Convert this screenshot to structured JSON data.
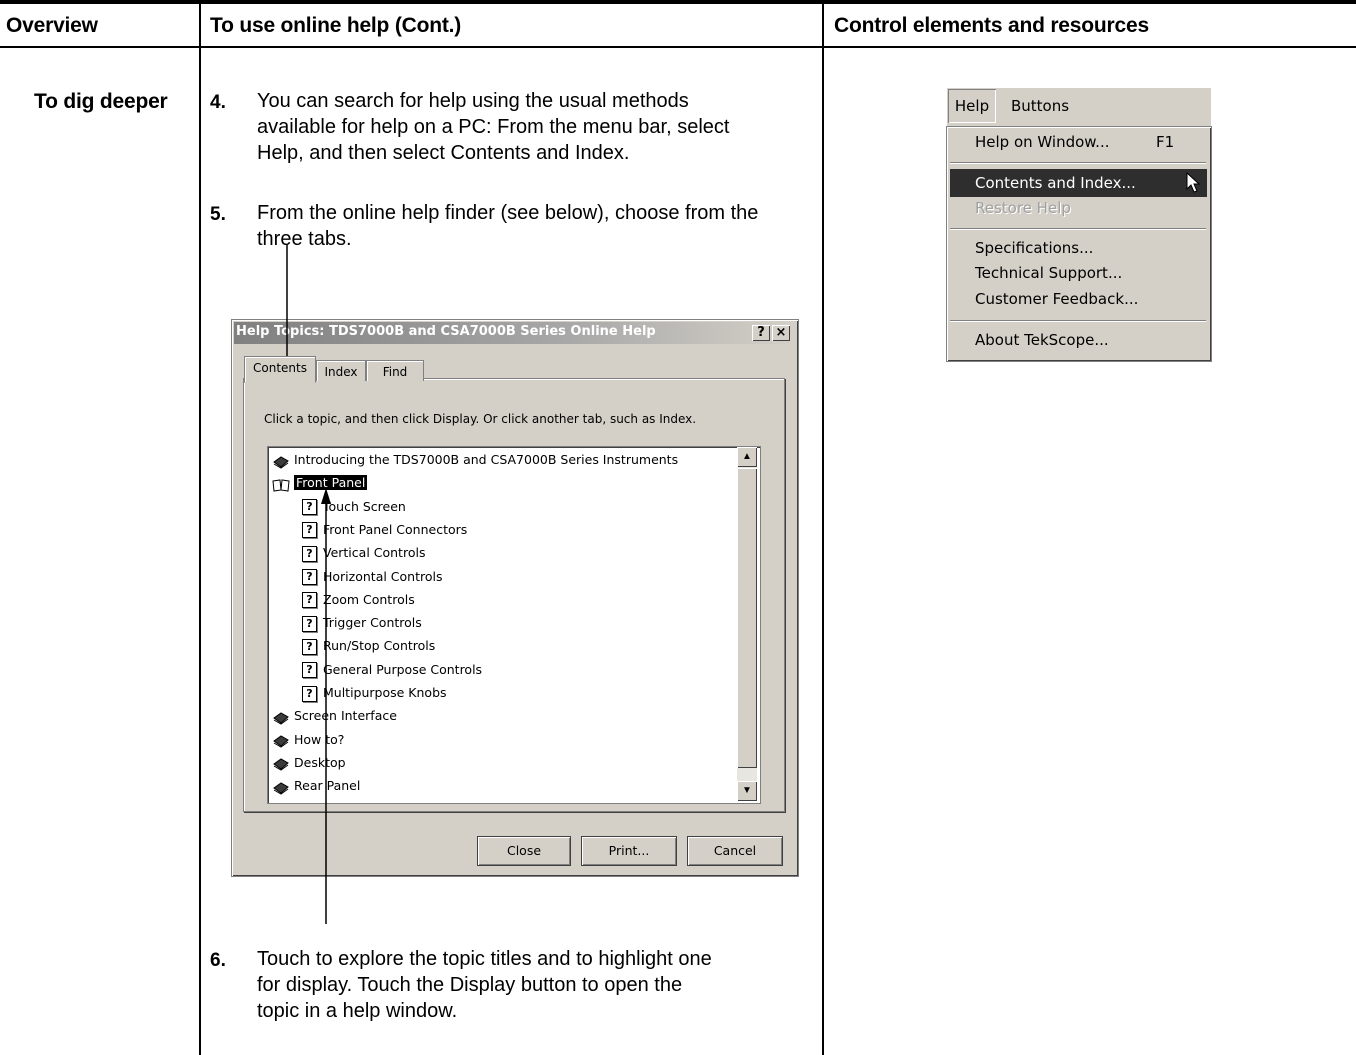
{
  "header": {
    "col1": "Overview",
    "col2": "To use online help (Cont.)",
    "col3": "Control elements and resources"
  },
  "section_label": "To dig deeper",
  "steps": [
    {
      "num": "4.",
      "lines": [
        "You can search for help using the usual methods",
        "available for help on a PC: From the menu bar, select",
        "Help, and then select Contents and Index."
      ]
    },
    {
      "num": "5.",
      "lines": [
        "From the online help finder (see below), choose from the",
        "three tabs."
      ]
    },
    {
      "num": "6.",
      "lines": [
        "Touch to explore the topic titles and to highlight one",
        "for display. Touch the Display button to open the",
        "topic in a help window."
      ]
    }
  ],
  "dialog": {
    "title": "Help Topics: TDS7000B and CSA7000B Series Online Help",
    "help_btn": "?",
    "close_btn": "×",
    "tabs": [
      "Contents",
      "Index",
      "Find"
    ],
    "instruction": "Click a topic, and then click Display. Or click another tab, such as Index.",
    "tree": [
      {
        "type": "book",
        "label": "Introducing the TDS7000B and CSA7000B Series Instruments"
      },
      {
        "type": "open-book",
        "label": "Front Panel",
        "selected": true
      },
      {
        "type": "topic",
        "label": "Touch Screen"
      },
      {
        "type": "topic",
        "label": "Front Panel Connectors"
      },
      {
        "type": "topic",
        "label": "Vertical Controls"
      },
      {
        "type": "topic",
        "label": "Horizontal Controls"
      },
      {
        "type": "topic",
        "label": "Zoom Controls"
      },
      {
        "type": "topic",
        "label": "Trigger Controls"
      },
      {
        "type": "topic",
        "label": "Run/Stop Controls"
      },
      {
        "type": "topic",
        "label": "General Purpose Controls"
      },
      {
        "type": "topic",
        "label": "Multipurpose Knobs"
      },
      {
        "type": "book",
        "label": "Screen Interface"
      },
      {
        "type": "book",
        "label": "How to?"
      },
      {
        "type": "book",
        "label": "Desktop"
      },
      {
        "type": "book",
        "label": "Rear Panel"
      }
    ],
    "buttons": {
      "close": "Close",
      "print": "Print...",
      "cancel": "Cancel"
    },
    "topic_icon": "?"
  },
  "menu": {
    "bar": [
      "Help",
      "Buttons"
    ],
    "items": [
      {
        "label": "Help on Window...",
        "shortcut": "F1",
        "state": "normal"
      },
      {
        "label": "Contents and Index...",
        "shortcut": "",
        "state": "highlighted"
      },
      {
        "label": "Restore Help",
        "shortcut": "",
        "state": "disabled"
      },
      {
        "label": "Specifications...",
        "shortcut": "",
        "state": "normal"
      },
      {
        "label": "Technical Support...",
        "shortcut": "",
        "state": "normal"
      },
      {
        "label": "Customer Feedback...",
        "shortcut": "",
        "state": "normal"
      },
      {
        "label": "About TekScope...",
        "shortcut": "",
        "state": "normal"
      }
    ]
  }
}
